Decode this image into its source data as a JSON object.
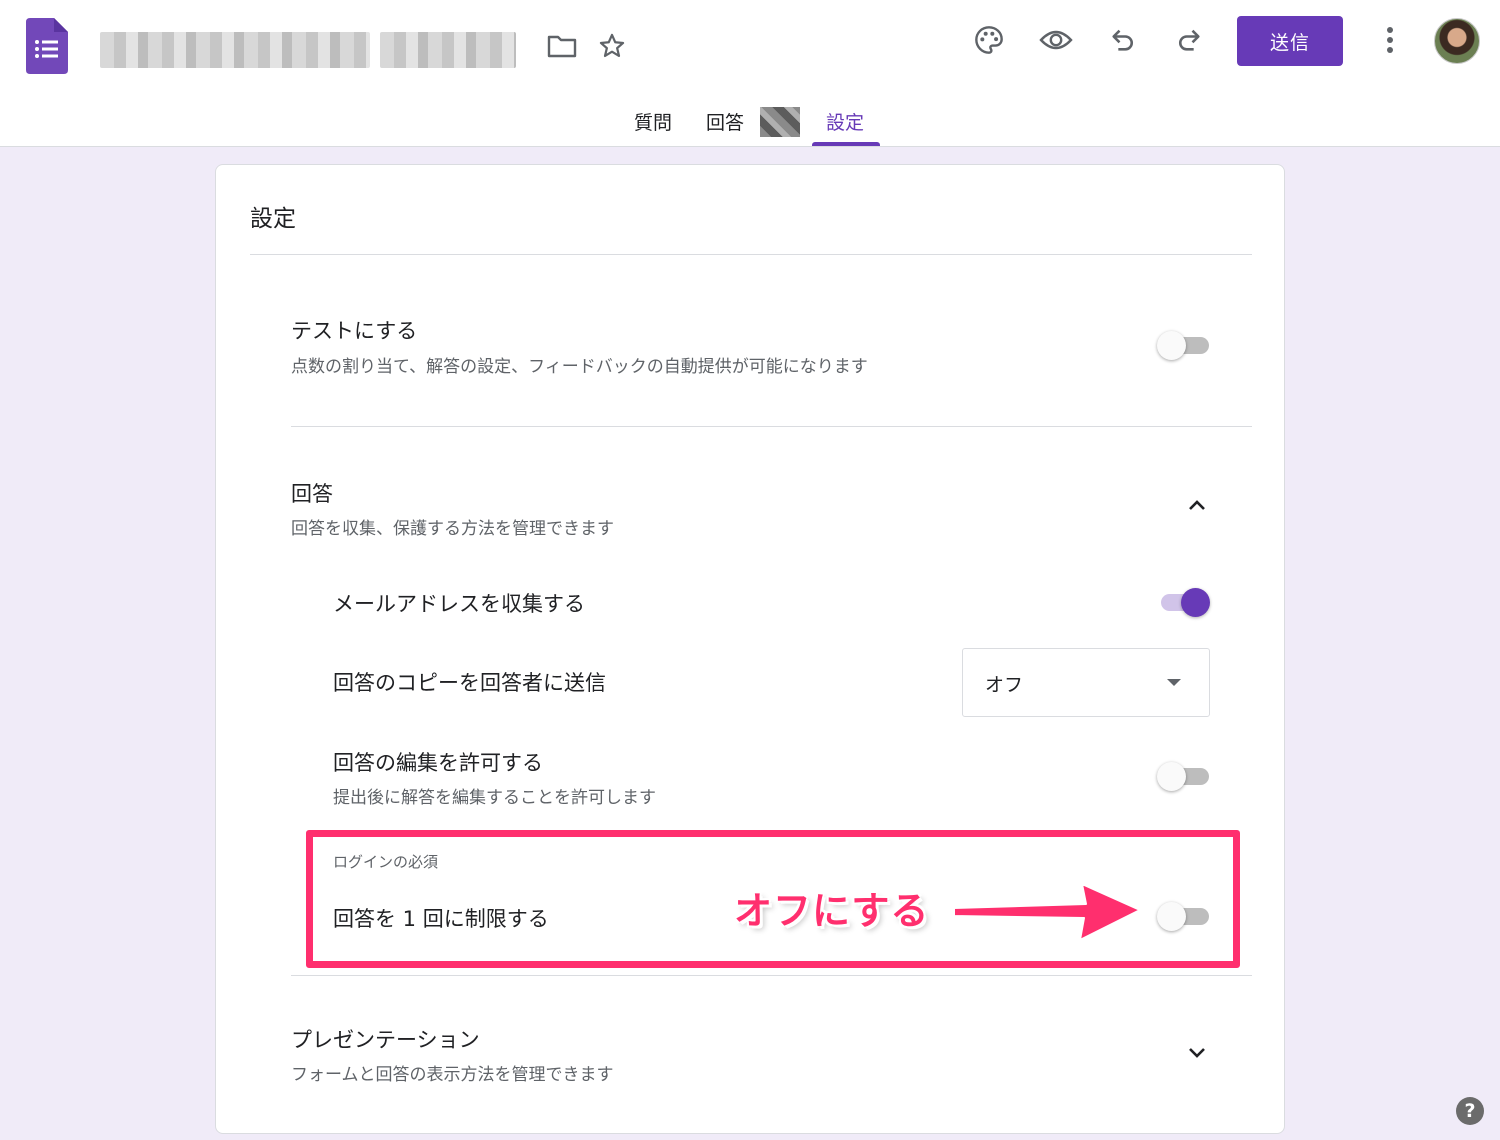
{
  "header": {
    "send_label": "送信"
  },
  "tabs": [
    {
      "label": "質問"
    },
    {
      "label": "回答"
    },
    {
      "label": "設定"
    }
  ],
  "settings": {
    "title": "設定",
    "quiz": {
      "title": "テストにする",
      "description": "点数の割り当て、解答の設定、フィードバックの自動提供が可能になります",
      "enabled": false
    },
    "responses": {
      "title": "回答",
      "description": "回答を収集、保護する方法を管理できます",
      "expanded": true,
      "collect_email": {
        "label": "メールアドレスを収集する",
        "enabled": true
      },
      "send_copy": {
        "label": "回答のコピーを回答者に送信",
        "value": "オフ"
      },
      "allow_edit": {
        "label": "回答の編集を許可する",
        "description": "提出後に解答を編集することを許可します",
        "enabled": false
      },
      "login_required": {
        "group_label": "ログインの必須",
        "limit_one": {
          "label": "回答を 1 回に制限する",
          "enabled": false
        }
      }
    },
    "presentation": {
      "title": "プレゼンテーション",
      "description": "フォームと回答の表示方法を管理できます",
      "expanded": false
    }
  },
  "annotation": {
    "text": "オフにする",
    "color": "#ff2f6e"
  },
  "help": {
    "label": "?"
  },
  "colors": {
    "accent": "#673ab7",
    "background": "#f0ebf8"
  }
}
